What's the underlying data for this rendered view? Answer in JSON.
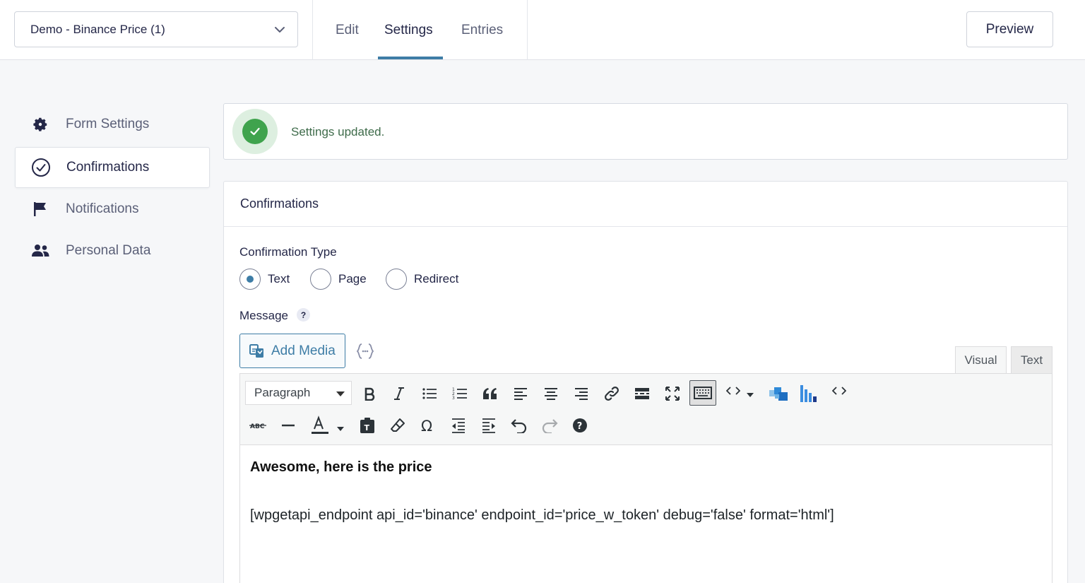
{
  "header": {
    "form_name": "Demo - Binance Price (1)",
    "tabs": [
      {
        "label": "Edit"
      },
      {
        "label": "Settings",
        "active": true
      },
      {
        "label": "Entries"
      }
    ],
    "preview_label": "Preview",
    "accent_color": "#3e7da6"
  },
  "sidebar": {
    "items": [
      {
        "label": "Form Settings",
        "icon": "gear-icon"
      },
      {
        "label": "Confirmations",
        "icon": "check-circle-icon",
        "active": true
      },
      {
        "label": "Notifications",
        "icon": "flag-icon"
      },
      {
        "label": "Personal Data",
        "icon": "users-icon"
      }
    ]
  },
  "notice": {
    "message": "Settings updated.",
    "color": "#3fa34d"
  },
  "panel": {
    "title": "Confirmations",
    "confirmation_type_label": "Confirmation Type",
    "types": [
      {
        "label": "Text",
        "selected": true
      },
      {
        "label": "Page",
        "selected": false
      },
      {
        "label": "Redirect",
        "selected": false
      }
    ],
    "message_label": "Message",
    "help_glyph": "?",
    "add_media_label": "Add Media",
    "editor_tabs": {
      "visual": "Visual",
      "text": "Text"
    },
    "format_select": "Paragraph",
    "content": {
      "heading": "Awesome, here is the price",
      "shortcode": "[wpgetapi_endpoint api_id='binance' endpoint_id='price_w_token' debug='false' format='html']"
    }
  }
}
